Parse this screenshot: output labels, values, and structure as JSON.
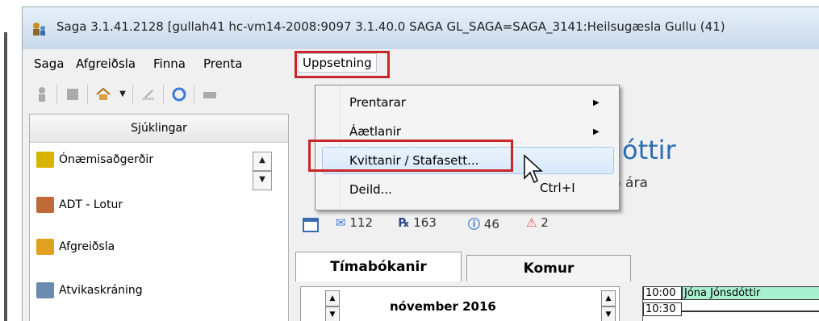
{
  "window": {
    "title": "Saga 3.1.41.2128   [gullah41 hc-vm14-2008:9097 3.1.40.0 SAGA GL_SAGA=SAGA_3141:Heilsugæsla Gullu (41)"
  },
  "menubar": {
    "items": [
      "Saga",
      "Afgreiðsla",
      "Finna",
      "Prenta",
      "Uppsetning"
    ]
  },
  "dropdown": {
    "items": [
      {
        "label": "Prentarar",
        "submenu": true
      },
      {
        "label": "Áætlanir",
        "submenu": true
      },
      {
        "label": "Kvittanir / Stafasett...",
        "submenu": false,
        "highlighted": true
      },
      {
        "label": "Deild...",
        "submenu": false,
        "shortcut": "Ctrl+I"
      }
    ],
    "arrow_glyph": "▶"
  },
  "sidebar": {
    "header": "Sjúklingar",
    "items": [
      {
        "label": "Ónæmisaðgerðir",
        "icon": "vaccination-icon",
        "color": "#d8b400"
      },
      {
        "label": "ADT - Lotur",
        "icon": "person-icon",
        "color": "#c06a3a"
      },
      {
        "label": "Afgreiðsla",
        "icon": "reception-icon",
        "color": "#e0a020"
      },
      {
        "label": "Atvikaskráning",
        "icon": "incident-icon",
        "color": "#6a8ab0"
      }
    ],
    "scroll_up": "▲",
    "scroll_down": "▼"
  },
  "patient": {
    "name_suffix": "sdóttir",
    "age": "46 ára"
  },
  "stats": {
    "messages": "112",
    "prescriptions": "163",
    "info": "46",
    "warnings": "2"
  },
  "tabs": [
    "Tímabókanir",
    "Komur"
  ],
  "calendar": {
    "month": "nóvember 2016"
  },
  "schedule": [
    {
      "time": "10:00",
      "name": "Jóna Jónsdóttir"
    },
    {
      "time": "10:30",
      "name": ""
    }
  ],
  "colors": {
    "highlight_red": "#c8262a",
    "accent_blue": "#2a6db5",
    "schedule_green": "#a8f0d0"
  }
}
